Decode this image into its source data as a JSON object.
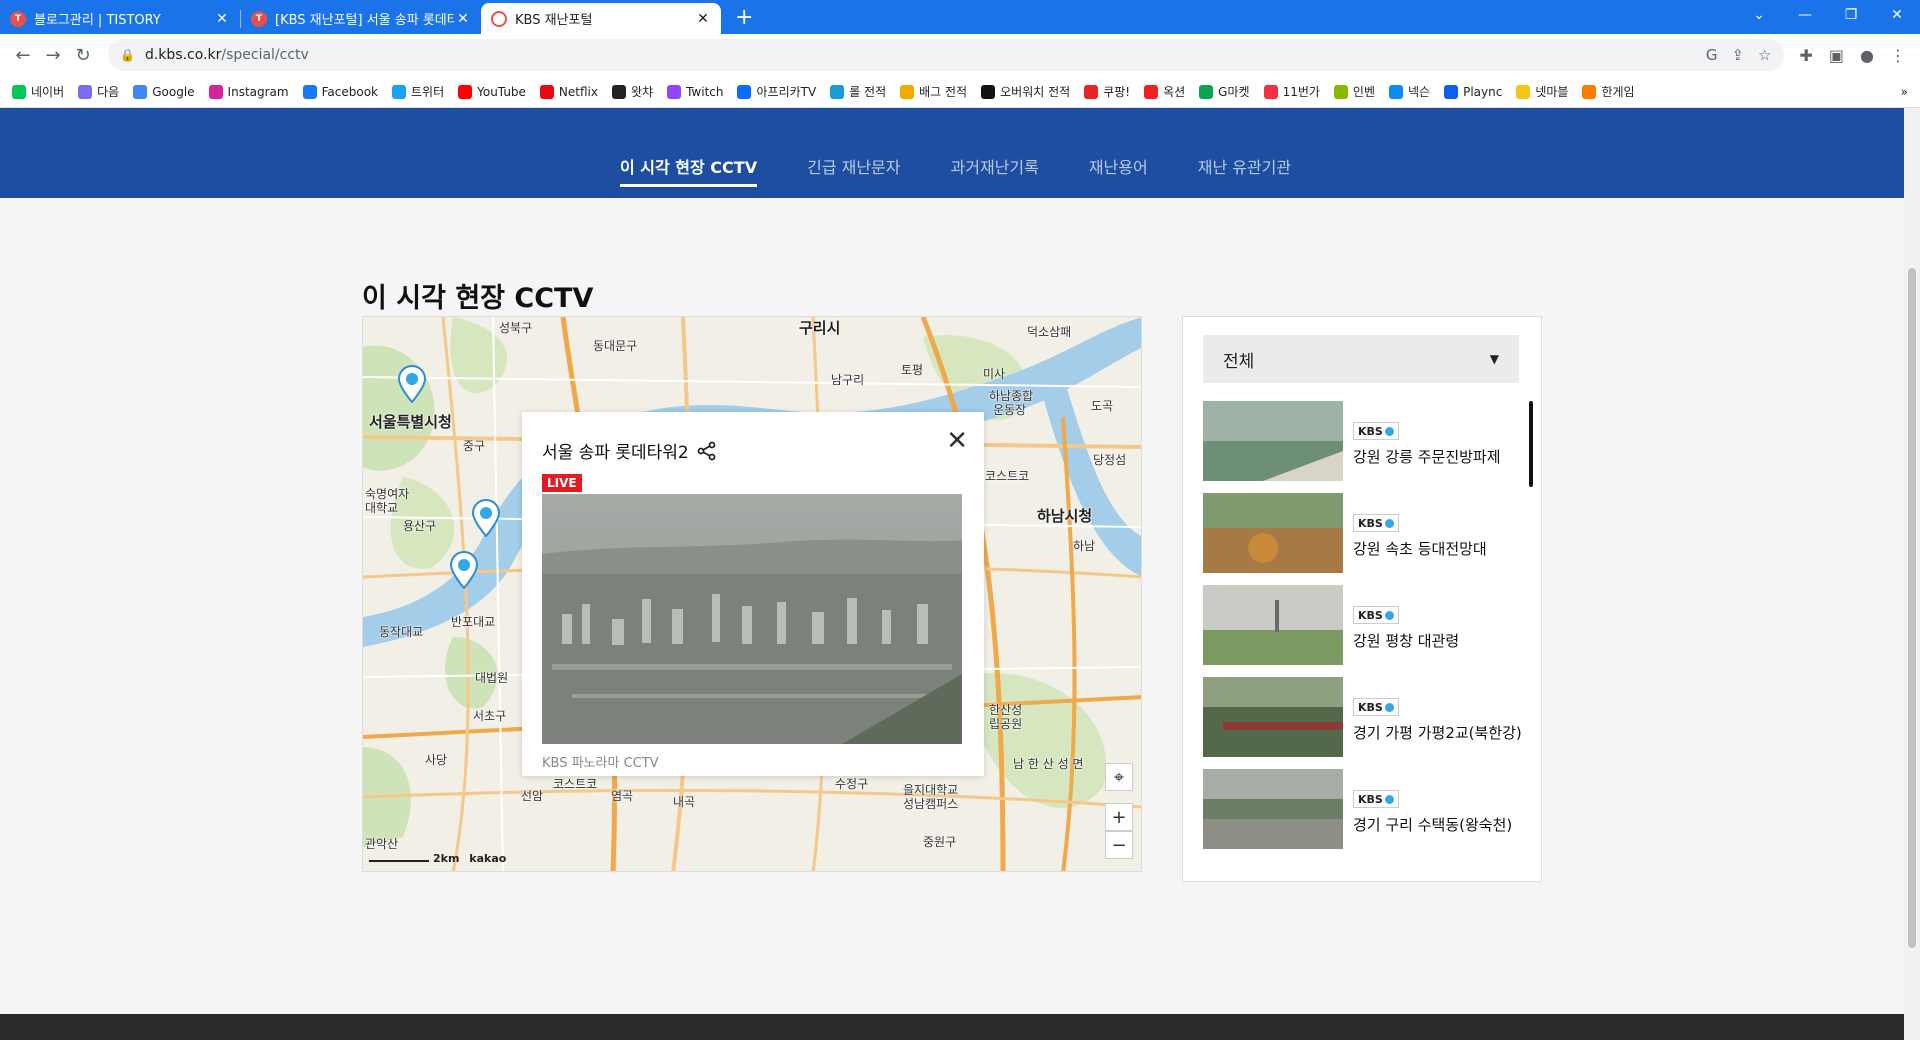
{
  "browser": {
    "tabs": [
      {
        "title": "블로그관리 | TISTORY",
        "active": false
      },
      {
        "title": "[KBS 재난포털] 서울 송파 롯데타",
        "active": false
      },
      {
        "title": "KBS 재난포털",
        "active": true
      }
    ],
    "url_host": "d.kbs.co.kr",
    "url_path": "/special/cctv",
    "bookmarks": [
      "네이버",
      "다음",
      "Google",
      "Instagram",
      "Facebook",
      "트위터",
      "YouTube",
      "Netflix",
      "왓챠",
      "Twitch",
      "아프리카TV",
      "롤 전적",
      "배그 전적",
      "오버워치 전적",
      "쿠팡!",
      "옥션",
      "G마켓",
      "11번가",
      "인벤",
      "넥슨",
      "Plaync",
      "넷마블",
      "한게임"
    ],
    "bookmark_colors": [
      "#03c75a",
      "#7b6cf0",
      "#4285f4",
      "#d6249f",
      "#1877f2",
      "#1da1f2",
      "#ff0000",
      "#e50914",
      "#222",
      "#9146ff",
      "#0b6cff",
      "#1a9cd8",
      "#f2a900",
      "#111",
      "#e52528",
      "#e22",
      "#0ca44e",
      "#f43142",
      "#8b0",
      "#0a8cf0",
      "#0f5ef0",
      "#f5c518",
      "#ff7b00"
    ]
  },
  "header": {
    "tabs": [
      {
        "label": "이 시각 현장 CCTV",
        "active": true
      },
      {
        "label": "긴급 재난문자",
        "active": false
      },
      {
        "label": "과거재난기록",
        "active": false
      },
      {
        "label": "재난용어",
        "active": false
      },
      {
        "label": "재난 유관기관",
        "active": false
      }
    ]
  },
  "main": {
    "title": "이 시각 현장 CCTV"
  },
  "map": {
    "labels": [
      {
        "text": "성북구"
      },
      {
        "text": "구리시"
      },
      {
        "text": "덕소삼패"
      },
      {
        "text": "동대문구"
      },
      {
        "text": "남구리"
      },
      {
        "text": "토평"
      },
      {
        "text": "미사"
      },
      {
        "text": "서울특별시청"
      },
      {
        "text": "하남종합"
      },
      {
        "text": "운동장"
      },
      {
        "text": "중구"
      },
      {
        "text": "도곡"
      },
      {
        "text": "당정섬"
      },
      {
        "text": "숙명여자"
      },
      {
        "text": "대학교"
      },
      {
        "text": "용산구"
      },
      {
        "text": "코스트코"
      },
      {
        "text": "하남시청"
      },
      {
        "text": "하남"
      },
      {
        "text": "동작대교"
      },
      {
        "text": "반포대교"
      },
      {
        "text": "대법원"
      },
      {
        "text": "서초구"
      },
      {
        "text": "사당"
      },
      {
        "text": "한산성"
      },
      {
        "text": "립공원"
      },
      {
        "text": "남 한 산 성 면"
      },
      {
        "text": "선암"
      },
      {
        "text": "코스트코"
      },
      {
        "text": "염곡"
      },
      {
        "text": "내곡"
      },
      {
        "text": "수정구"
      },
      {
        "text": "을지대학교"
      },
      {
        "text": "성남캠퍼스"
      },
      {
        "text": "중원구"
      },
      {
        "text": "관악산"
      }
    ],
    "scale_label": "2km",
    "brand": "kakao"
  },
  "popup": {
    "title": "서울 송파 롯데타워2",
    "live_label": "LIVE",
    "source": "KBS 파노라마 CCTV",
    "close_icon": "close-icon",
    "share_icon": "share-icon"
  },
  "side": {
    "filter": "전체",
    "items": [
      {
        "badge": "KBS",
        "name": "강원 강릉 주문진방파제"
      },
      {
        "badge": "KBS",
        "name": "강원 속초 등대전망대"
      },
      {
        "badge": "KBS",
        "name": "강원 평창 대관령"
      },
      {
        "badge": "KBS",
        "name": "경기 가평 가평2교(북한강)"
      },
      {
        "badge": "KBS",
        "name": "경기 구리 수택동(왕숙천)"
      }
    ]
  },
  "colors": {
    "accent": "#1d4ea0",
    "live": "#e31b23",
    "chrome": "#1a73e8"
  }
}
